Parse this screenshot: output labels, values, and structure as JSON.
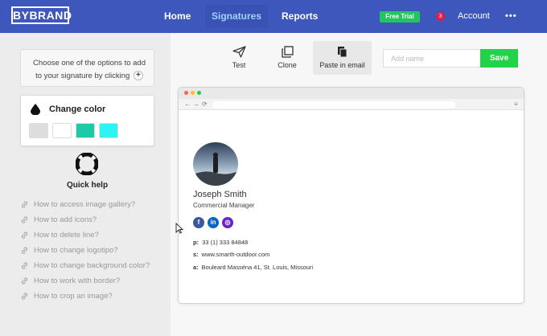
{
  "header": {
    "logo": "BYBRAND",
    "nav": {
      "home": "Home",
      "signatures": "Signatures",
      "reports": "Reports"
    },
    "free_trial": "Free Trial",
    "notification_count": "3",
    "account": "Account",
    "more": "•••",
    "colors": {
      "bar": "#3d57bd",
      "trial": "#22c55e",
      "badge": "#e11d48"
    }
  },
  "sidebar": {
    "add_hint_line1": "Choose one of the options to add",
    "add_hint_line2": "to your signature by clicking",
    "change_color": {
      "title": "Change color",
      "swatches": [
        "#dedede",
        "#ffffff",
        "#1fc9a8",
        "#2ef3f3"
      ]
    },
    "quick_help": {
      "title": "Quick help",
      "items": [
        "How to access image gallery?",
        "How to add icons?",
        "How to delete line?",
        "How to change logotipo?",
        "How to change background color?",
        "How to work with border?",
        "How to crop an image?"
      ]
    }
  },
  "toolbar": {
    "test": "Test",
    "clone": "Clone",
    "paste": "Paste in email",
    "name_placeholder": "Add name",
    "save": "Save"
  },
  "signature": {
    "name": "Joseph Smith",
    "title": "Commercial Manager",
    "social": [
      "facebook-icon",
      "linkedin-icon",
      "instagram-icon"
    ],
    "phone_label": "p:",
    "phone": "33 (1) 333 84848",
    "site_label": "s:",
    "site": "www.smarth-outdoor.com",
    "address_label": "a:",
    "address": "Bouleard Masséna 41, St. Louis, Missouri"
  }
}
